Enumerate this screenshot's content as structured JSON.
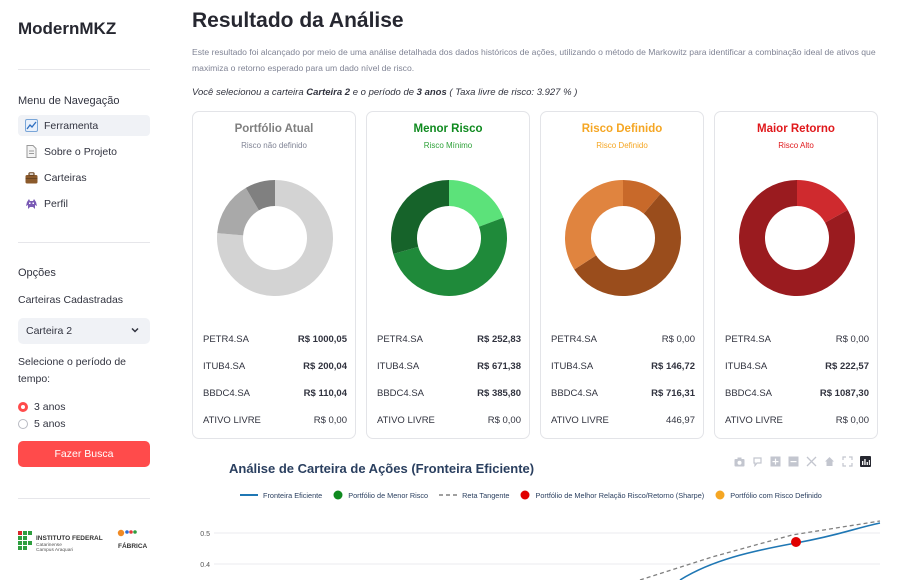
{
  "sidebar": {
    "brand": "ModernMKZ",
    "nav_heading": "Menu de Navegação",
    "nav_items": [
      {
        "label": "Ferramenta",
        "icon": "chart-icon"
      },
      {
        "label": "Sobre o Projeto",
        "icon": "document-icon"
      },
      {
        "label": "Carteiras",
        "icon": "briefcase-icon"
      },
      {
        "label": "Perfil",
        "icon": "alien-icon"
      }
    ],
    "options_heading": "Opções",
    "carteiras_label": "Carteiras Cadastradas",
    "carteira_selected": "Carteira 2",
    "periodo_label": "Selecione o período de tempo:",
    "periodo_options": [
      "3 anos",
      "5 anos"
    ],
    "periodo_selected": "3 anos",
    "search_button": "Fazer Busca",
    "logo_if_text": "INSTITUTO FEDERAL",
    "logo_if_sub1": "Catarinense",
    "logo_if_sub2": "Campus Araquari",
    "logo_fabrica_text": "FÁBRICA"
  },
  "main": {
    "title": "Resultado da Análise",
    "description": "Este resultado foi alcançado por meio de uma análise detalhada dos dados históricos de ações, utilizando o método de Markowitz para identificar a combinação ideal de ativos que maximiza o retorno esperado para um dado nível de risco.",
    "selection": {
      "prefix": "Você selecionou a carteira ",
      "carteira": "Carteira 2",
      "middle": " e o período de ",
      "periodo": "3 anos",
      "suffix": " ( Taxa livre de risco: 3.927 % )"
    }
  },
  "colors": {
    "accent": "#ff4b4b",
    "green": "#0f8a1f",
    "orange": "#f5a623",
    "red": "#e0181b",
    "gray": "#7f7f7f"
  },
  "cards": [
    {
      "title": "Portfólio Atual",
      "subtitle": "Risco não definido",
      "title_color": "#7f7f7f",
      "sub_color": "#808495",
      "slice_colors": [
        "#d3d3d3",
        "#a9a9a9",
        "#808080"
      ],
      "rows": [
        {
          "ticker": "PETR4.SA",
          "value": "R$ 1000,05",
          "bold": true
        },
        {
          "ticker": "ITUB4.SA",
          "value": "R$ 200,04",
          "bold": true
        },
        {
          "ticker": "BBDC4.SA",
          "value": "R$ 110,04",
          "bold": true
        },
        {
          "ticker": "ATIVO LIVRE",
          "value": "R$ 0,00",
          "bold": false
        }
      ]
    },
    {
      "title": "Menor Risco",
      "subtitle": "Risco Mínimo",
      "title_color": "#0f8a1f",
      "sub_color": "#2fa23a",
      "slice_colors": [
        "#5ce27a",
        "#1f8a3a",
        "#16632a"
      ],
      "rows": [
        {
          "ticker": "PETR4.SA",
          "value": "R$ 252,83",
          "bold": true
        },
        {
          "ticker": "ITUB4.SA",
          "value": "R$ 671,38",
          "bold": true
        },
        {
          "ticker": "BBDC4.SA",
          "value": "R$ 385,80",
          "bold": true
        },
        {
          "ticker": "ATIVO LIVRE",
          "value": "R$ 0,00",
          "bold": false
        }
      ]
    },
    {
      "title": "Risco Definido",
      "subtitle": "Risco Definido",
      "title_color": "#f5a623",
      "sub_color": "#f5a623",
      "slice_colors": [
        "#e0843f",
        "#c8692a",
        "#9a4d1c"
      ],
      "rows": [
        {
          "ticker": "PETR4.SA",
          "value": "R$ 0,00",
          "bold": false
        },
        {
          "ticker": "ITUB4.SA",
          "value": "R$ 146,72",
          "bold": true
        },
        {
          "ticker": "BBDC4.SA",
          "value": "R$ 716,31",
          "bold": true
        },
        {
          "ticker": "ATIVO LIVRE",
          "value": "446,97",
          "bold": false
        }
      ]
    },
    {
      "title": "Maior Retorno",
      "subtitle": "Risco Alto",
      "title_color": "#e0181b",
      "sub_color": "#e0181b",
      "slice_colors": [
        "#a01a1f",
        "#cf2a2e",
        "#9a1b1f"
      ],
      "rows": [
        {
          "ticker": "PETR4.SA",
          "value": "R$ 0,00",
          "bold": false
        },
        {
          "ticker": "ITUB4.SA",
          "value": "R$ 222,57",
          "bold": true
        },
        {
          "ticker": "BBDC4.SA",
          "value": "R$ 1087,30",
          "bold": true
        },
        {
          "ticker": "ATIVO LIVRE",
          "value": "R$ 0,00",
          "bold": false
        }
      ]
    }
  ],
  "chart_data": {
    "type": "line",
    "title": "Análise de Carteira de Ações (Fronteira Eficiente)",
    "legend": [
      {
        "name": "Fronteira Eficiente",
        "symbol": "line",
        "color": "#1f77b4"
      },
      {
        "name": "Portfólio de Menor Risco",
        "symbol": "marker",
        "color": "#0f8a1f"
      },
      {
        "name": "Reta Tangente",
        "symbol": "dash",
        "color": "#808080"
      },
      {
        "name": "Portfólio de Melhor Relação Risco/Retorno (Sharpe)",
        "symbol": "marker",
        "color": "#e00000"
      },
      {
        "name": "Portfólio com Risco Definido",
        "symbol": "marker",
        "color": "#f5a623"
      }
    ],
    "legend_placement": "top",
    "y_ticks": [
      0.5,
      0.4
    ],
    "ylim_visible": [
      0.35,
      0.53
    ],
    "modebar_icons": [
      "camera-icon",
      "zoom-icon",
      "zoom-in-icon",
      "zoom-out-icon",
      "autoscale-icon",
      "home-icon",
      "fullscreen-icon",
      "plotly-logo-icon"
    ]
  }
}
